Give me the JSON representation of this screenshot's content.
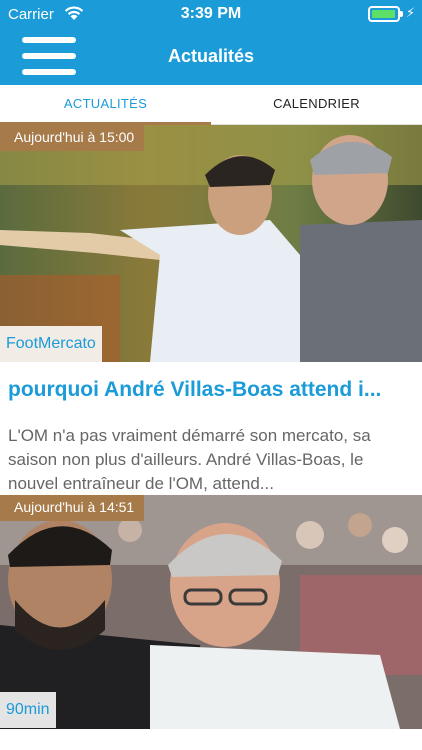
{
  "status_bar": {
    "carrier": "Carrier",
    "time": "3:39 PM",
    "battery_level": 0.95
  },
  "nav": {
    "title": "Actualités",
    "menu_icon": "hamburger-menu-icon"
  },
  "tabs": [
    {
      "label": "ACTUALITÉS",
      "active": true
    },
    {
      "label": "CALENDRIER",
      "active": false
    }
  ],
  "articles": [
    {
      "timestamp": "Aujourd'hui à 15:00",
      "source": "FootMercato",
      "headline": "pourquoi André Villas-Boas attend i...",
      "summary": "L'OM n'a pas vraiment démarré son mercato, sa saison non plus d'ailleurs. André Villas-Boas, le nouvel entraîneur de l'OM, attend..."
    },
    {
      "timestamp": "Aujourd'hui à 14:51",
      "source": "90min"
    }
  ],
  "colors": {
    "brand_blue": "#1b9bd8",
    "badge_brown": "#a77a4a",
    "text_gray": "#666666"
  }
}
